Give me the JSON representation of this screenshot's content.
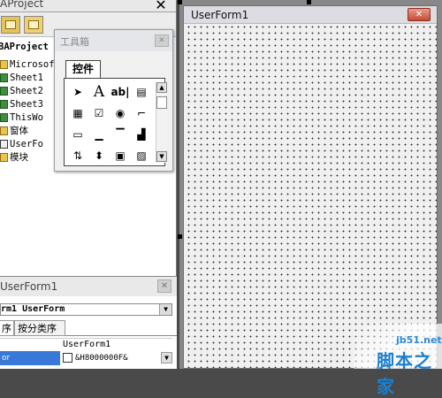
{
  "project_explorer": {
    "title": "AProject",
    "close_glyph": "✕",
    "tree": [
      {
        "label": "BAProject",
        "icon": "vba-project-icon"
      },
      {
        "label": "Microsoft",
        "icon": "folder-icon"
      },
      {
        "label": "Sheet1",
        "icon": "sheet-icon"
      },
      {
        "label": "Sheet2",
        "icon": "sheet-icon"
      },
      {
        "label": "Sheet3",
        "icon": "sheet-icon"
      },
      {
        "label": "ThisWo",
        "icon": "workbook-icon"
      },
      {
        "label": "窗体",
        "icon": "folder-icon"
      },
      {
        "label": "UserFo",
        "icon": "userform-icon"
      },
      {
        "label": "模块",
        "icon": "folder-icon"
      }
    ]
  },
  "toolbox": {
    "title": "工具箱",
    "close_glyph": "✕",
    "tab_label": "控件",
    "tools": [
      {
        "name": "select-objects-tool",
        "glyph": "➤"
      },
      {
        "name": "label-tool",
        "glyph": "A"
      },
      {
        "name": "textbox-tool",
        "glyph": "ab|"
      },
      {
        "name": "combobox-tool",
        "glyph": "▤"
      },
      {
        "name": "listbox-tool",
        "glyph": "▦"
      },
      {
        "name": "checkbox-tool",
        "glyph": "☑"
      },
      {
        "name": "optionbutton-tool",
        "glyph": "◉"
      },
      {
        "name": "togglebutton-tool",
        "glyph": "⌐"
      },
      {
        "name": "frame-tool",
        "glyph": "▭"
      },
      {
        "name": "commandbutton-tool",
        "glyph": "▁"
      },
      {
        "name": "tabstrip-tool",
        "glyph": "▔"
      },
      {
        "name": "multipage-tool",
        "glyph": "▟"
      },
      {
        "name": "scrollbar-tool",
        "glyph": "⇅"
      },
      {
        "name": "spinbutton-tool",
        "glyph": "⬍"
      },
      {
        "name": "image-tool",
        "glyph": "▣"
      },
      {
        "name": "refedit-tool",
        "glyph": "▨"
      }
    ]
  },
  "properties": {
    "title": "UserForm1",
    "close_glyph": "✕",
    "object_combo": "rm1 UserForm",
    "tabs": [
      "序",
      "按分类序"
    ],
    "header_value": "UserForm1",
    "selected_property": "or",
    "selected_value": "&H8000000F&"
  },
  "designer": {
    "form_title": "UserForm1",
    "close_glyph": "✕"
  },
  "watermark": {
    "url": "jb51.net",
    "text": "脚本之家"
  }
}
